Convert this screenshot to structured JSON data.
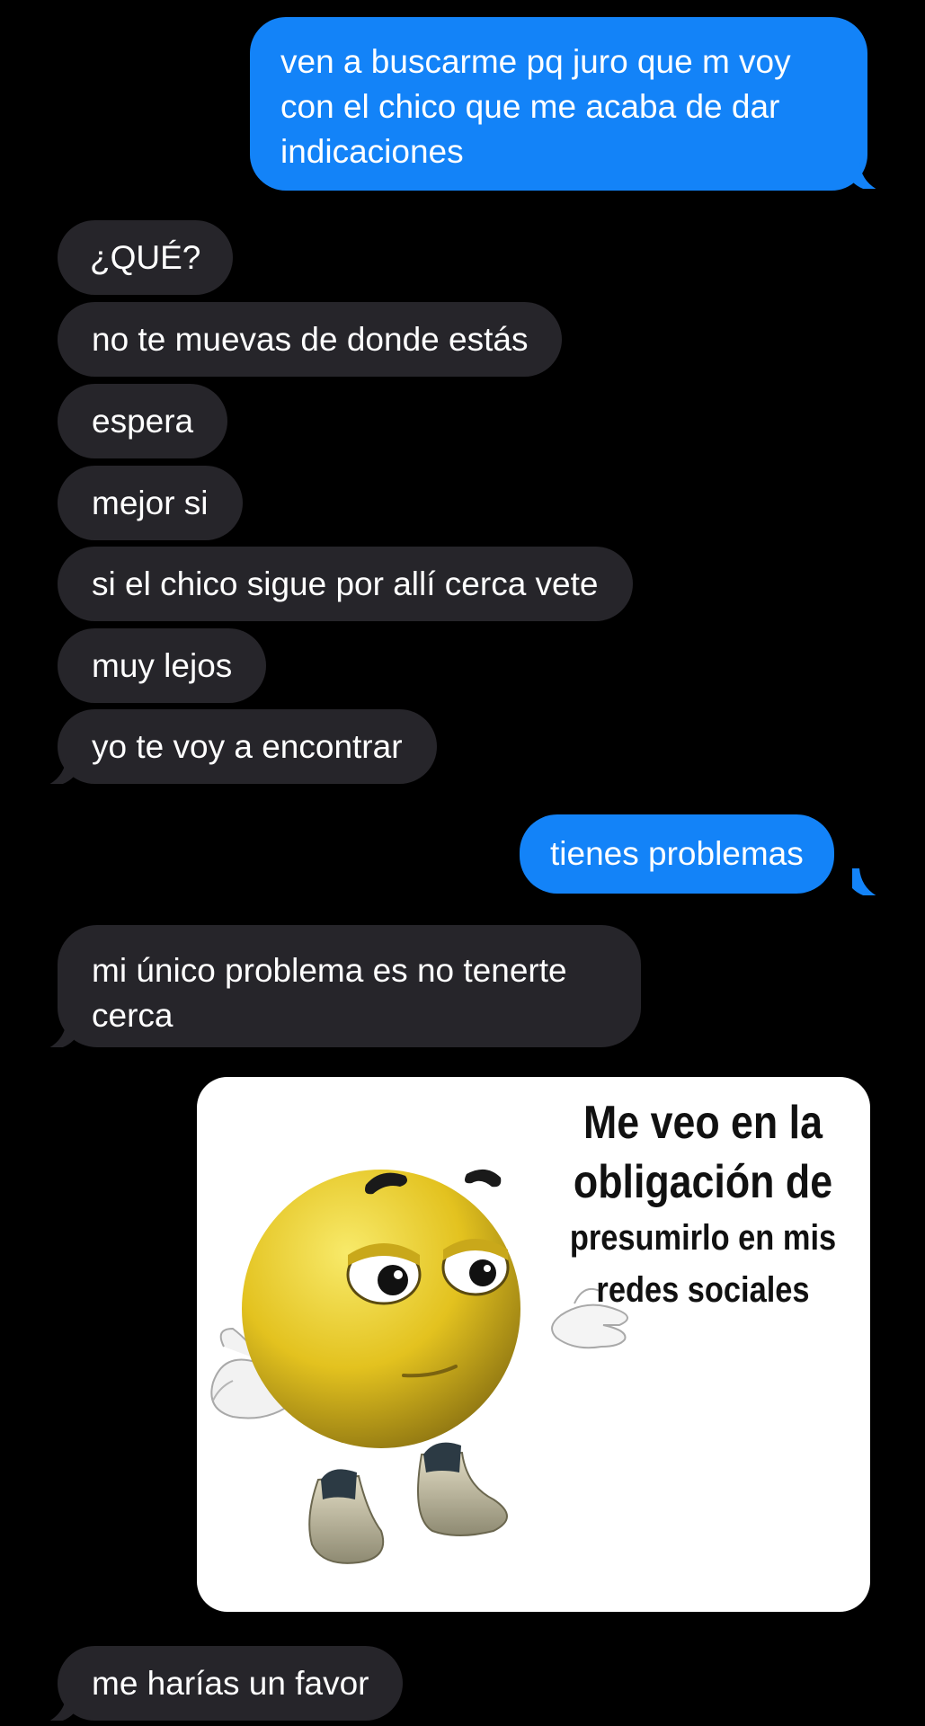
{
  "colors": {
    "background": "#000000",
    "outgoing_bubble": "#1383f8",
    "incoming_bubble": "#26252a",
    "text": "#ffffff"
  },
  "messages": [
    {
      "direction": "outgoing",
      "text": "ven a buscarme pq juro que m voy con el chico que me acaba de dar indicaciones"
    },
    {
      "direction": "incoming",
      "text": "¿QUÉ?"
    },
    {
      "direction": "incoming",
      "text": "no te muevas de donde estás"
    },
    {
      "direction": "incoming",
      "text": "espera"
    },
    {
      "direction": "incoming",
      "text": "mejor si"
    },
    {
      "direction": "incoming",
      "text": "si el chico sigue por allí cerca vete"
    },
    {
      "direction": "incoming",
      "text": "muy lejos"
    },
    {
      "direction": "incoming",
      "text": "yo te voy a encontrar"
    },
    {
      "direction": "outgoing",
      "text": "tienes problemas"
    },
    {
      "direction": "incoming",
      "text": "mi único problema es no tenerte cerca"
    },
    {
      "direction": "incoming",
      "type": "image",
      "image": {
        "caption_line1": "Me veo en la",
        "caption_line2": "obligación de",
        "caption_line3": "presumirlo en mis",
        "caption_line4": "redes sociales"
      }
    },
    {
      "direction": "incoming",
      "text": "me harías un favor"
    }
  ]
}
